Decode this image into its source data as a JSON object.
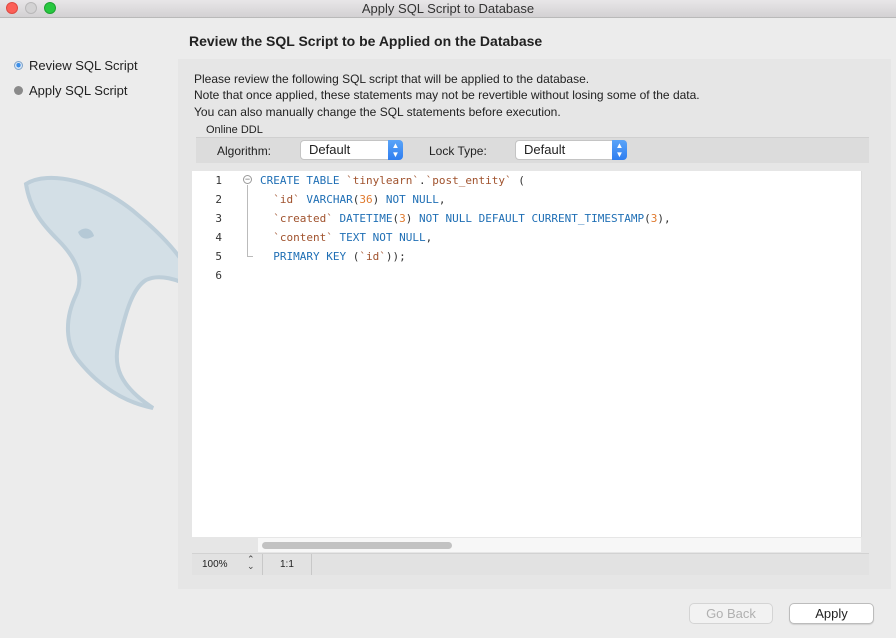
{
  "window": {
    "title": "Apply SQL Script to Database"
  },
  "sidebar": {
    "steps": [
      {
        "label": "Review SQL Script",
        "state": "active"
      },
      {
        "label": "Apply SQL Script",
        "state": "inactive"
      }
    ],
    "logo_icon": "dolphin-watermark-icon"
  },
  "main": {
    "heading": "Review the SQL Script to be Applied on the Database",
    "description": [
      "Please review the following SQL script that will be applied to the database.",
      "Note that once applied, these statements may not be revertible without losing some of the data.",
      "You can also manually change the SQL statements before execution."
    ],
    "online_ddl": {
      "section_label": "Online DDL",
      "algorithm_label": "Algorithm:",
      "algorithm_value": "Default",
      "lock_type_label": "Lock Type:",
      "lock_type_value": "Default"
    }
  },
  "editor": {
    "line_numbers": [
      "1",
      "2",
      "3",
      "4",
      "5",
      "6"
    ],
    "lines": [
      [
        [
          "kw",
          "CREATE TABLE "
        ],
        [
          "tk",
          "`tinylearn`"
        ],
        [
          "pl",
          "."
        ],
        [
          "tk",
          "`post_entity`"
        ],
        [
          "pl",
          " ("
        ]
      ],
      [
        [
          "tk",
          "  `id`"
        ],
        [
          "kw",
          " VARCHAR"
        ],
        [
          "pl",
          "("
        ],
        [
          "num",
          "36"
        ],
        [
          "pl",
          ")"
        ],
        [
          "kw",
          " NOT NULL"
        ],
        [
          "pl",
          ","
        ]
      ],
      [
        [
          "tk",
          "  `created`"
        ],
        [
          "kw",
          " DATETIME"
        ],
        [
          "pl",
          "("
        ],
        [
          "num",
          "3"
        ],
        [
          "pl",
          ")"
        ],
        [
          "kw",
          " NOT NULL DEFAULT CURRENT_TIMESTAMP"
        ],
        [
          "pl",
          "("
        ],
        [
          "num",
          "3"
        ],
        [
          "pl",
          "),"
        ]
      ],
      [
        [
          "tk",
          "  `content`"
        ],
        [
          "kw",
          " TEXT NOT NULL"
        ],
        [
          "pl",
          ","
        ]
      ],
      [
        [
          "kw",
          "  PRIMARY KEY "
        ],
        [
          "pl",
          "("
        ],
        [
          "tk",
          "`id`"
        ],
        [
          "pl",
          "));"
        ]
      ],
      []
    ]
  },
  "statusbar": {
    "zoom": "100%",
    "cursor_position": "1:1"
  },
  "buttons": {
    "go_back": "Go Back",
    "apply": "Apply"
  },
  "colors": {
    "keyword": "#1f6fb5",
    "identifier": "#a0522d",
    "number": "#e07a2e",
    "accent": "#2f7ef0"
  }
}
